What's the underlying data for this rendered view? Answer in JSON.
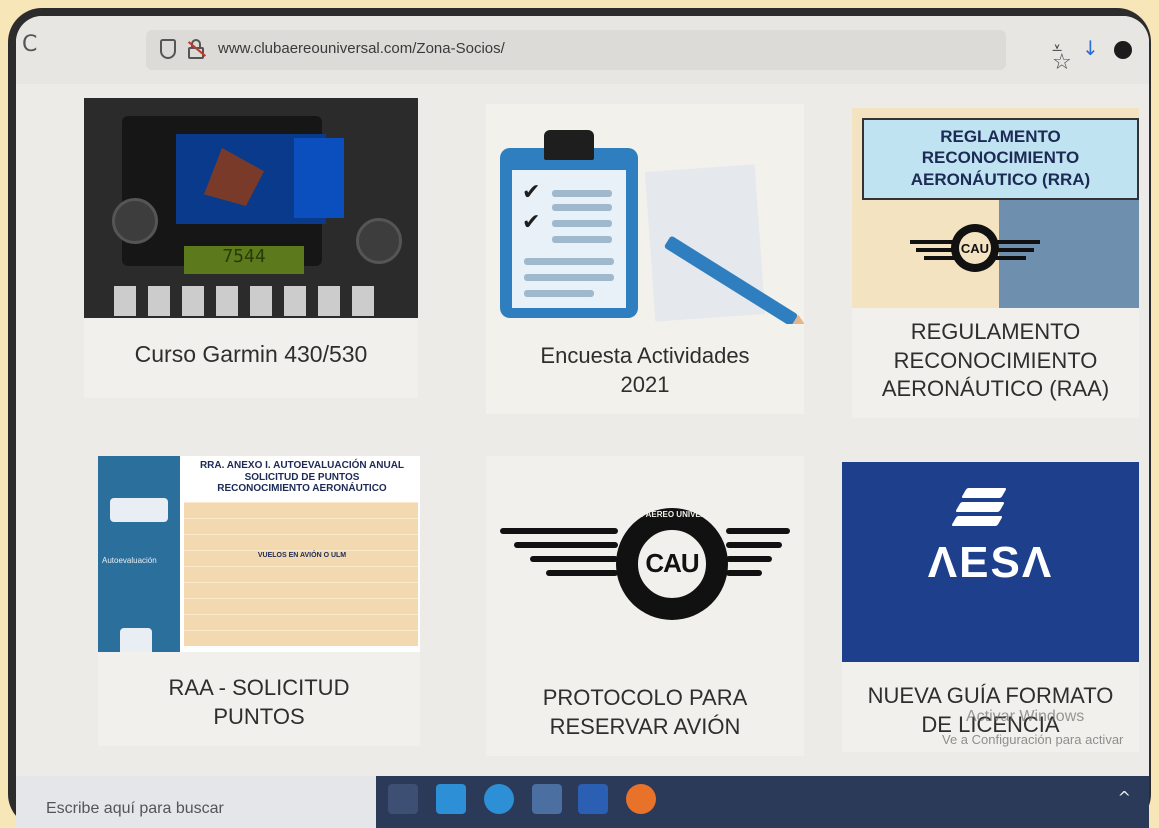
{
  "browser": {
    "url": "www.clubaereouniversal.com/Zona-Socios/",
    "reload_glyph": "C",
    "star_glyph": "☆",
    "pocket_glyph": "⩡",
    "download_glyph": "↓"
  },
  "cards": [
    {
      "caption": "Curso Garmin 430/530"
    },
    {
      "caption_line1": "Encuesta Actividades",
      "caption_line2": "2021"
    },
    {
      "caption_line1": "REGULAMENTO",
      "caption_line2": "RECONOCIMIENTO",
      "caption_line3": "AERONÁUTICO (RAA)",
      "image_title_line1": "REGLAMENTO",
      "image_title_line2": "RECONOCIMIENTO",
      "image_title_line3": "AERONÁUTICO (RRA)"
    },
    {
      "caption_line1": "RAA - SOLICITUD",
      "caption_line2": "PUNTOS",
      "doc_header_line1": "RRA. ANEXO I. AUTOEVALUACIÓN ANUAL",
      "doc_header_line2": "SOLICITUD DE PUNTOS",
      "doc_header_line3": "RECONOCIMIENTO AERONÁUTICO",
      "doc_side_label": "Autoevaluación",
      "doc_section": "VUELOS EN AVIÓN O ULM"
    },
    {
      "caption_line1": "PROTOCOLO PARA",
      "caption_line2": "RESERVAR AVIÓN",
      "logo_text": "CAU",
      "logo_arc": "CLUB AEREO UNIVERSAL"
    },
    {
      "caption_line1": "NUEVA GUÍA FORMATO",
      "caption_line2": "DE LICENCIA",
      "logo_text": "ΛESΛ"
    }
  ],
  "watermark": {
    "line1": "Activar Windows",
    "line2": "Ve a Configuración para activar"
  },
  "taskbar": {
    "search_placeholder": "Escribe aquí para buscar",
    "tray_glyph": "^"
  }
}
